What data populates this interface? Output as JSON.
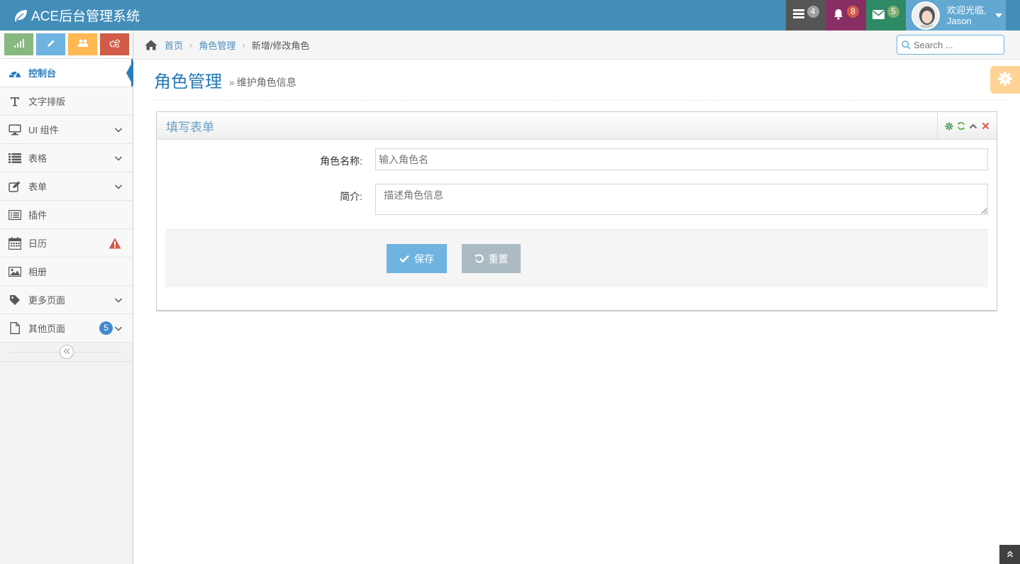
{
  "app": {
    "title": "ACE后台管理系统"
  },
  "navbar": {
    "tasks_count": "4",
    "notifications_count": "8",
    "messages_count": "5",
    "user": {
      "welcome": "欢迎光临,",
      "name": "Jason"
    }
  },
  "sidebar": {
    "items": [
      {
        "label": "控制台"
      },
      {
        "label": "文字排版"
      },
      {
        "label": "UI 组件"
      },
      {
        "label": "表格"
      },
      {
        "label": "表单"
      },
      {
        "label": "插件"
      },
      {
        "label": "日历"
      },
      {
        "label": "相册"
      },
      {
        "label": "更多页面"
      },
      {
        "label": "其他页面",
        "badge": "5"
      }
    ]
  },
  "breadcrumb": {
    "home": "首页",
    "section": "角色管理",
    "current": "新增/修改角色"
  },
  "search": {
    "placeholder": "Search ..."
  },
  "page": {
    "title": "角色管理",
    "subtitle": "维护角色信息"
  },
  "form": {
    "title": "填写表单",
    "name_label": "角色名称:",
    "name_placeholder": "输入角色名",
    "desc_label": "简介:",
    "desc_placeholder": "描述角色信息",
    "save_label": "保存",
    "reset_label": "重置"
  },
  "colors": {
    "navbar": "#438eb9",
    "accent": "#2b7dbc",
    "save": "#6fb3e0",
    "reset": "#abbac3"
  }
}
